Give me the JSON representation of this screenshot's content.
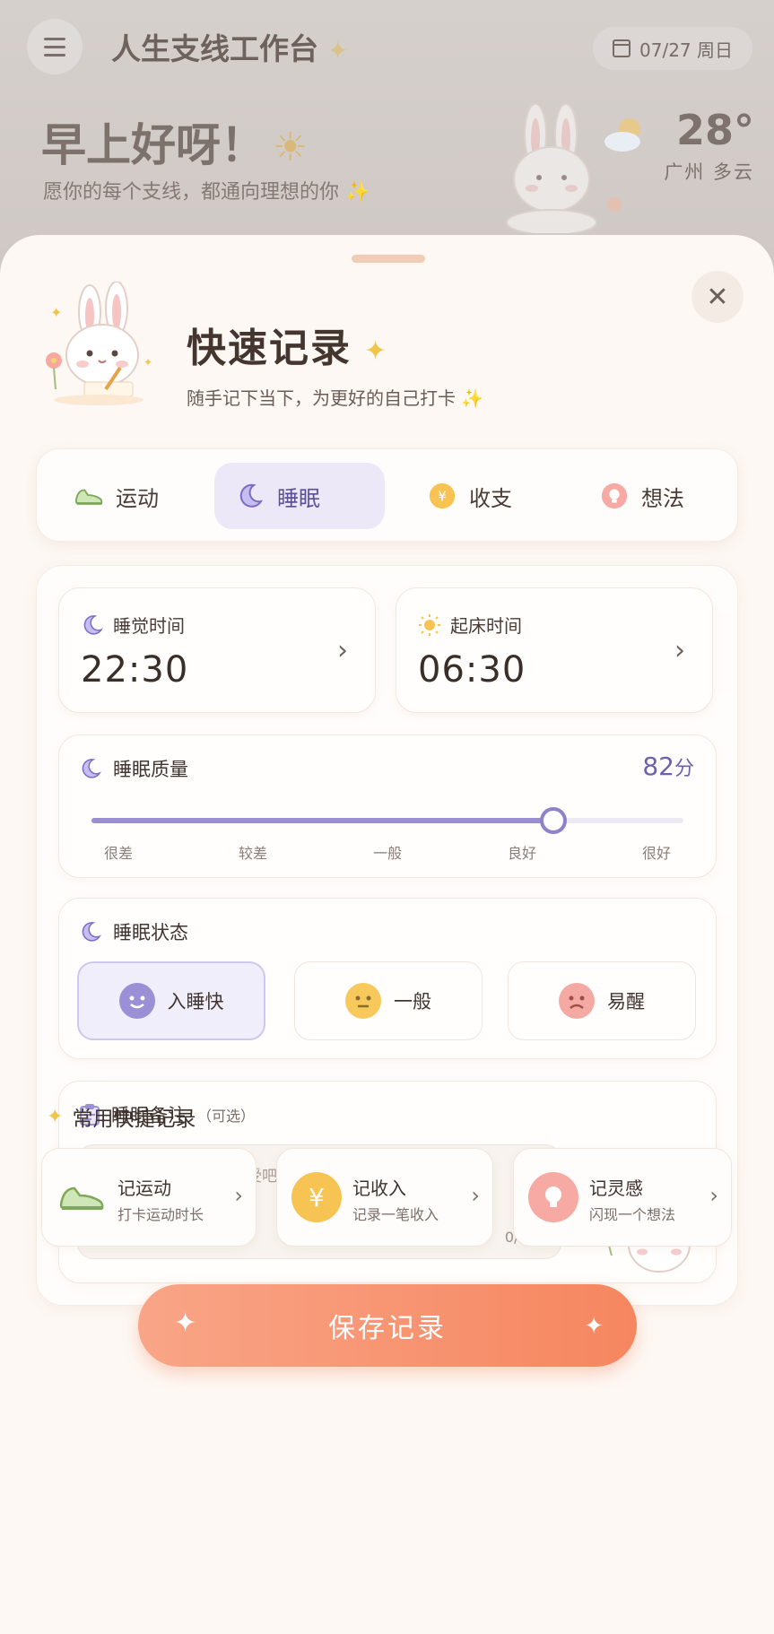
{
  "background": {
    "app_title": "人生支线工作台",
    "date": "07/27 周日",
    "greeting": "早上好呀！",
    "greeting_sub": "愿你的每个支线，都通向理想的你",
    "temperature": "28°",
    "city_weather": "广州 多云"
  },
  "sheet": {
    "close_label": "✕",
    "title": "快速记录",
    "subtitle": "随手记下当下，为更好的自己打卡",
    "tabs": [
      {
        "label": "运动",
        "icon": "sneaker-icon",
        "active": false
      },
      {
        "label": "睡眠",
        "icon": "moon-icon",
        "active": true
      },
      {
        "label": "收支",
        "icon": "yen-coin-icon",
        "active": false
      },
      {
        "label": "想法",
        "icon": "lightbulb-icon",
        "active": false
      }
    ],
    "sleep_time": {
      "label": "睡觉时间",
      "value": "22:30"
    },
    "wake_time": {
      "label": "起床时间",
      "value": "06:30"
    },
    "quality": {
      "label": "睡眠质量",
      "score": "82",
      "unit": "分",
      "level_fraction": 0.78,
      "scale": [
        "很差",
        "较差",
        "一般",
        "良好",
        "很好"
      ]
    },
    "state": {
      "label": "睡眠状态",
      "options": [
        {
          "label": "入睡快",
          "selected": true
        },
        {
          "label": "一般",
          "selected": false
        },
        {
          "label": "易醒",
          "selected": false
        }
      ]
    },
    "note": {
      "label": "睡眠备注",
      "optional": "（可选）",
      "placeholder": "记录一下昨晚的睡眠感受吧～",
      "count": "0/100"
    },
    "quick": {
      "title": "常用快捷记录",
      "items": [
        {
          "title": "记运动",
          "sub": "打卡运动时长"
        },
        {
          "title": "记收入",
          "sub": "记录一笔收入"
        },
        {
          "title": "记灵感",
          "sub": "闪现一个想法"
        }
      ]
    },
    "save_label": "保存记录"
  },
  "colors": {
    "accent_purple": "#8f82c8",
    "save_orange": "#f6865f",
    "sheet_bg": "#fdf8f4"
  }
}
